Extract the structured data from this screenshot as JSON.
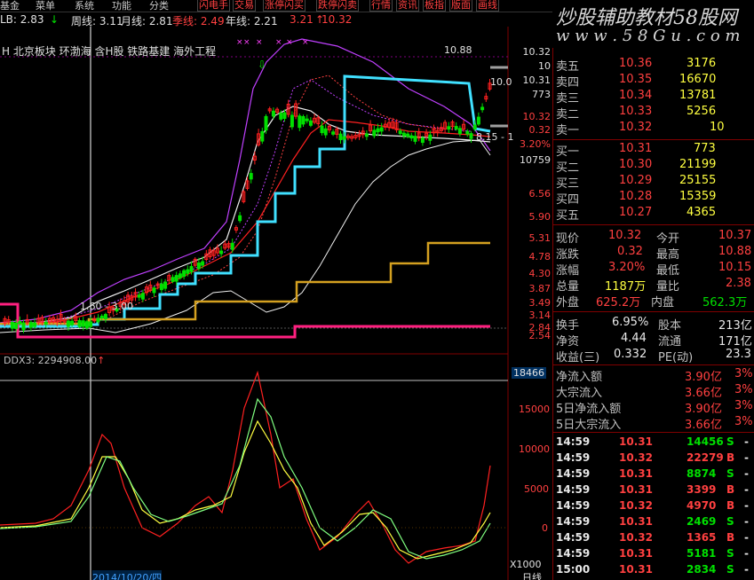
{
  "menu": {
    "items": [
      "基金",
      "菜单",
      "系统",
      "功能",
      "分类"
    ]
  },
  "toolbar": {
    "items": [
      "闪电手",
      "交易",
      "涨停闪买",
      "跌停闪卖",
      "行情",
      "资讯",
      "板指",
      "版面",
      "画线"
    ]
  },
  "ma_bar": {
    "prefix": "LB: 2.83",
    "week": "周线: 3.11",
    "month": "月线: 2.81",
    "season": "季线: 2.49",
    "year": "年线: 2.21",
    "extra1": "3.21",
    "extra2": "10.32"
  },
  "chart": {
    "concepts": "H 北京板块 环渤海 含H股 铁路基建 海外工程",
    "high_label": "10.88",
    "low_label": "1.60 - 3.00",
    "price_ticks": [
      "10.32",
      "10",
      "10.31",
      "773",
      "10.32",
      "0.32",
      "3.20%",
      "10759",
      "6.56",
      "5.90",
      "5.31",
      "4.78",
      "4.30",
      "3.87",
      "3.49",
      "3.14",
      "2.84",
      "2.54"
    ],
    "inset_text1": "10.0",
    "inset_text2": "8.15 - 1"
  },
  "ddx": {
    "label": "DDX3: 2294908.00",
    "ticks": [
      "18466",
      "15000",
      "10000",
      "5000",
      "0"
    ],
    "multiplier": "X1000",
    "date_label": "2014/10/20/四",
    "bottom_right": "日线"
  },
  "brand": {
    "title": "炒股辅助教材58股网",
    "url": "w w w . 5 8 G u . c o m"
  },
  "order_book": {
    "asks": [
      {
        "label": "卖五",
        "price": "10.36",
        "vol": "3176"
      },
      {
        "label": "卖四",
        "price": "10.35",
        "vol": "16670"
      },
      {
        "label": "卖三",
        "price": "10.34",
        "vol": "13781"
      },
      {
        "label": "卖二",
        "price": "10.33",
        "vol": "5256"
      },
      {
        "label": "卖一",
        "price": "10.32",
        "vol": "10"
      }
    ],
    "bids": [
      {
        "label": "买一",
        "price": "10.31",
        "vol": "773"
      },
      {
        "label": "买二",
        "price": "10.30",
        "vol": "21199"
      },
      {
        "label": "买三",
        "price": "10.29",
        "vol": "25155"
      },
      {
        "label": "买四",
        "price": "10.28",
        "vol": "15359"
      },
      {
        "label": "买五",
        "price": "10.27",
        "vol": "4365"
      }
    ]
  },
  "quote": {
    "rows": [
      {
        "l1": "现价",
        "v1": "10.32",
        "l2": "今开",
        "v2": "10.37"
      },
      {
        "l1": "涨跌",
        "v1": "0.32",
        "l2": "最高",
        "v2": "10.88"
      },
      {
        "l1": "涨幅",
        "v1": "3.20%",
        "l2": "最低",
        "v2": "10.15"
      },
      {
        "l1": "总量",
        "v1": "1187万",
        "l2": "量比",
        "v2": "2.38"
      },
      {
        "l1": "外盘",
        "v1": "625.2万",
        "l2": "内盘",
        "v2": "562.3万"
      }
    ]
  },
  "fund": {
    "rows": [
      {
        "l1": "换手",
        "v1": "6.95%",
        "l2": "股本",
        "v2": "213亿"
      },
      {
        "l1": "净资",
        "v1": "4.44",
        "l2": "流通",
        "v2": "171亿"
      },
      {
        "l1": "收益(三)",
        "v1": "0.332",
        "l2": "PE(动)",
        "v2": "23.3"
      }
    ]
  },
  "flow": {
    "rows": [
      {
        "label": "净流入额",
        "val": "3.90亿",
        "pct": "3%"
      },
      {
        "label": "大宗流入",
        "val": "3.66亿",
        "pct": "3%"
      },
      {
        "label": "5日净流入额",
        "val": "3.90亿",
        "pct": "3%"
      },
      {
        "label": "5日大宗流入",
        "val": "3.66亿",
        "pct": "3%"
      }
    ]
  },
  "ticks": {
    "rows": [
      {
        "time": "14:59",
        "price": "10.31",
        "vol": "14456",
        "side": "S",
        "dash": "-"
      },
      {
        "time": "14:59",
        "price": "10.32",
        "vol": "22279",
        "side": "B",
        "dash": "-"
      },
      {
        "time": "14:59",
        "price": "10.31",
        "vol": "8874",
        "side": "S",
        "dash": "-"
      },
      {
        "time": "14:59",
        "price": "10.31",
        "vol": "3399",
        "side": "B",
        "dash": "-"
      },
      {
        "time": "14:59",
        "price": "10.32",
        "vol": "4970",
        "side": "B",
        "dash": "-"
      },
      {
        "time": "14:59",
        "price": "10.31",
        "vol": "2469",
        "side": "S",
        "dash": "-"
      },
      {
        "time": "14:59",
        "price": "10.32",
        "vol": "1365",
        "side": "B",
        "dash": "-"
      },
      {
        "time": "14:59",
        "price": "10.31",
        "vol": "5181",
        "side": "S",
        "dash": "-"
      },
      {
        "time": "15:00",
        "price": "10.31",
        "vol": "2834",
        "side": "S",
        "dash": "-"
      }
    ]
  },
  "colors": {
    "up": "#ff4040",
    "down": "#00e000",
    "cyan": "#40e0ff",
    "gold": "#d4a020",
    "magenta": "#ff2080",
    "purple": "#c040ff"
  }
}
